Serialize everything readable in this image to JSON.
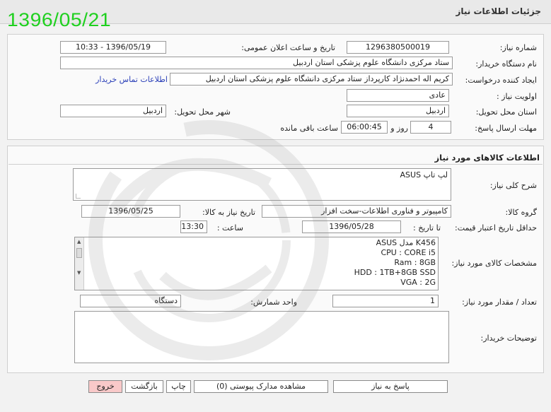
{
  "window": {
    "title": "جزئیات اطلاعات نیاز"
  },
  "date_stamp": "1396/05/21",
  "need_info": {
    "need_number_label": "شماره نیاز:",
    "need_number": "1296380500019",
    "announce_label": "تاریخ و ساعت اعلان عمومی:",
    "announce_value": "1396/05/19 - 10:33",
    "buyer_org_label": "نام دستگاه خریدار:",
    "buyer_org": "ستاد مرکزی دانشگاه علوم پزشکی استان اردبیل",
    "requester_label": "ایجاد کننده درخواست:",
    "requester": "کریم اله  احمدنژاد کارپرداز ستاد مرکزی دانشگاه علوم پزشکی استان اردبیل",
    "contact_link": "اطلاعات تماس خریدار",
    "priority_label": "اولویت نیاز :",
    "priority": "عادی",
    "province_label": "استان محل تحویل:",
    "province": "اردبیل",
    "city_label": "شهر محل تحویل:",
    "city": "اردبیل",
    "deadline_label": "مهلت ارسال پاسخ:",
    "days": "4",
    "days_word": "روز و",
    "time_left": "06:00:45",
    "time_left_suffix": "ساعت باقی مانده"
  },
  "goods": {
    "section_title": "اطلاعات کالاهای مورد نیاز",
    "summary_label": "شرح کلی نیاز:",
    "summary": "لپ تاپ ASUS",
    "group_label": "گروه کالا:",
    "group": "کامپیوتر و فناوری اطلاعات-سخت افزار",
    "need_date_label": "تاریخ نیاز به کالا:",
    "need_date": "1396/05/25",
    "validity_label": "حداقل تاریخ اعتبار قیمت:",
    "to_date_label": "تا تاریخ :",
    "to_date": "1396/05/28",
    "time_label": "ساعت :",
    "time": "13:30",
    "specs_label": "مشخصات کالای مورد نیاز:",
    "specs": [
      "ASUS مدل K456",
      "CPU : CORE i5",
      "Ram : 8GB",
      "HDD : 1TB+8GB SSD",
      "VGA : 2G"
    ],
    "qty_label": "تعداد / مقدار مورد نیاز:",
    "qty": "1",
    "unit_label": "واحد شمارش:",
    "unit": "دستگاه",
    "buyer_notes_label": "توضیحات خریدار:",
    "buyer_notes": ""
  },
  "buttons": {
    "reply": "پاسخ به نیاز",
    "attachments": "مشاهده مدارک پیوستی (0)",
    "print": "چاپ",
    "back": "بازگشت",
    "exit": "خروج"
  },
  "colors": {
    "stamp": "#1fd01f",
    "link": "#2a3fb8",
    "exit_button": "#f9c9c9"
  }
}
